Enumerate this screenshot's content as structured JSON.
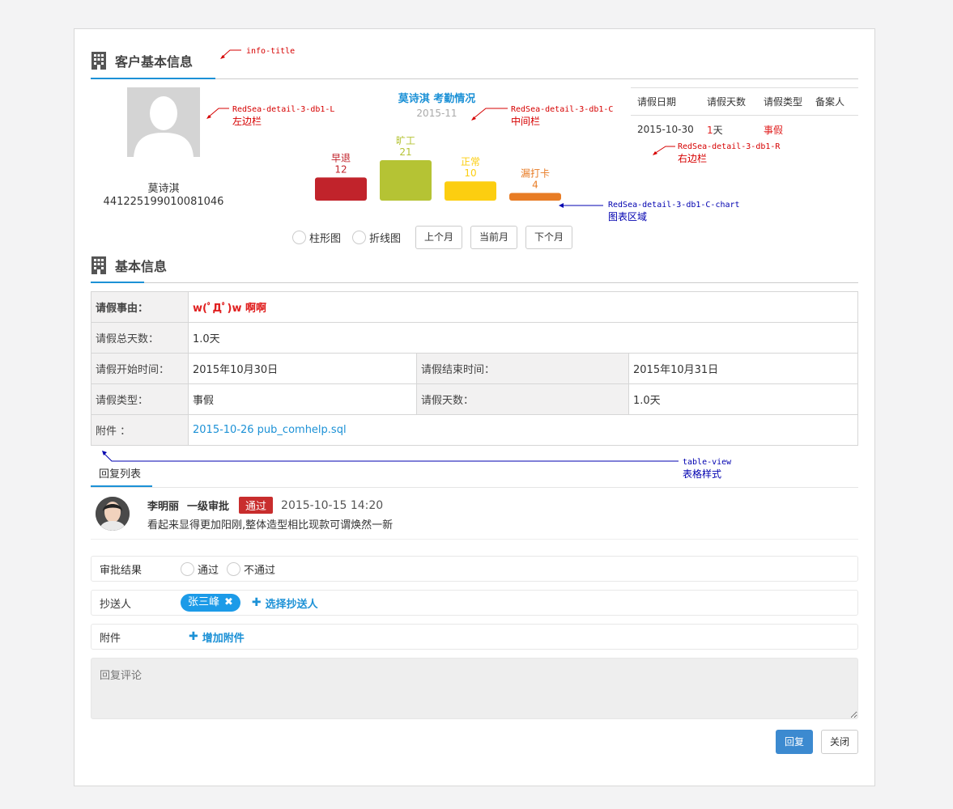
{
  "customer_section": {
    "title": "客户基本信息"
  },
  "employee": {
    "name": "莫诗淇",
    "id_number": "441225199010081046"
  },
  "chart": {
    "title": "莫诗淇 考勤情况",
    "period": "2015-11",
    "controls": {
      "bar_label": "柱形图",
      "line_label": "折线图",
      "prev_month": "上个月",
      "current_month": "当前月",
      "next_month": "下个月"
    }
  },
  "chart_data": {
    "type": "bar",
    "title": "莫诗淇 考勤情况",
    "subtitle": "2015-11",
    "categories": [
      "早退",
      "旷工",
      "正常",
      "漏打卡"
    ],
    "values": [
      12,
      21,
      10,
      4
    ],
    "colors": [
      "#c1232b",
      "#b5c334",
      "#fcce10",
      "#e87c25"
    ]
  },
  "leave_table": {
    "headers": [
      "请假日期",
      "请假天数",
      "请假类型",
      "备案人"
    ],
    "rows": [
      {
        "date": "2015-10-30",
        "days_num": "1",
        "days_unit": "天",
        "type": "事假",
        "filer": ""
      }
    ]
  },
  "basic_section": {
    "title": "基本信息"
  },
  "basic_info": {
    "reason_label": "请假事由：",
    "reason": "w(ﾟДﾟ)w 啊啊",
    "total_days_label": "请假总天数：",
    "total_days": "1.0天",
    "start_label": "请假开始时间：",
    "start": "2015年10月30日",
    "end_label": "请假结束时间：",
    "end": "2015年10月31日",
    "type_label": "请假类型：",
    "type": "事假",
    "days_label": "请假天数：",
    "days": "1.0天",
    "attachment_label": "附件 ：",
    "attachment": "2015-10-26 pub_comhelp.sql"
  },
  "reply_tab": {
    "label": "回复列表"
  },
  "reply": {
    "name": "李明丽",
    "role": "一级审批",
    "badge": "通过",
    "time": "2015-10-15 14:20",
    "content": "看起来显得更加阳刚,整体造型相比现款可谓焕然一新"
  },
  "form": {
    "result_label": "审批结果",
    "pass_label": "通过",
    "fail_label": "不通过",
    "cc_label": "抄送人",
    "cc_tag": "张三峰",
    "select_cc": "选择抄送人",
    "attach_label": "附件",
    "add_attach": "增加附件",
    "comment_placeholder": "回复评论"
  },
  "buttons": {
    "reply": "回复",
    "close": "关闭"
  },
  "colors": {
    "accent": "#1c91d6",
    "primary_btn": "#3c8ad0",
    "badge": "#c82d2d",
    "tag": "#1c9be8",
    "danger": "#e02020"
  },
  "annotations": {
    "info_title": "info-title",
    "left_code": "RedSea-detail-3-db1-L",
    "left_cn": "左边栏",
    "center_code": "RedSea-detail-3-db1-C",
    "center_cn": "中间栏",
    "right_code": "RedSea-detail-3-db1-R",
    "right_cn": "右边栏",
    "chart_code": "RedSea-detail-3-db1-C-chart",
    "chart_cn": "图表区域",
    "table_code": "table-view",
    "table_cn": "表格样式"
  }
}
